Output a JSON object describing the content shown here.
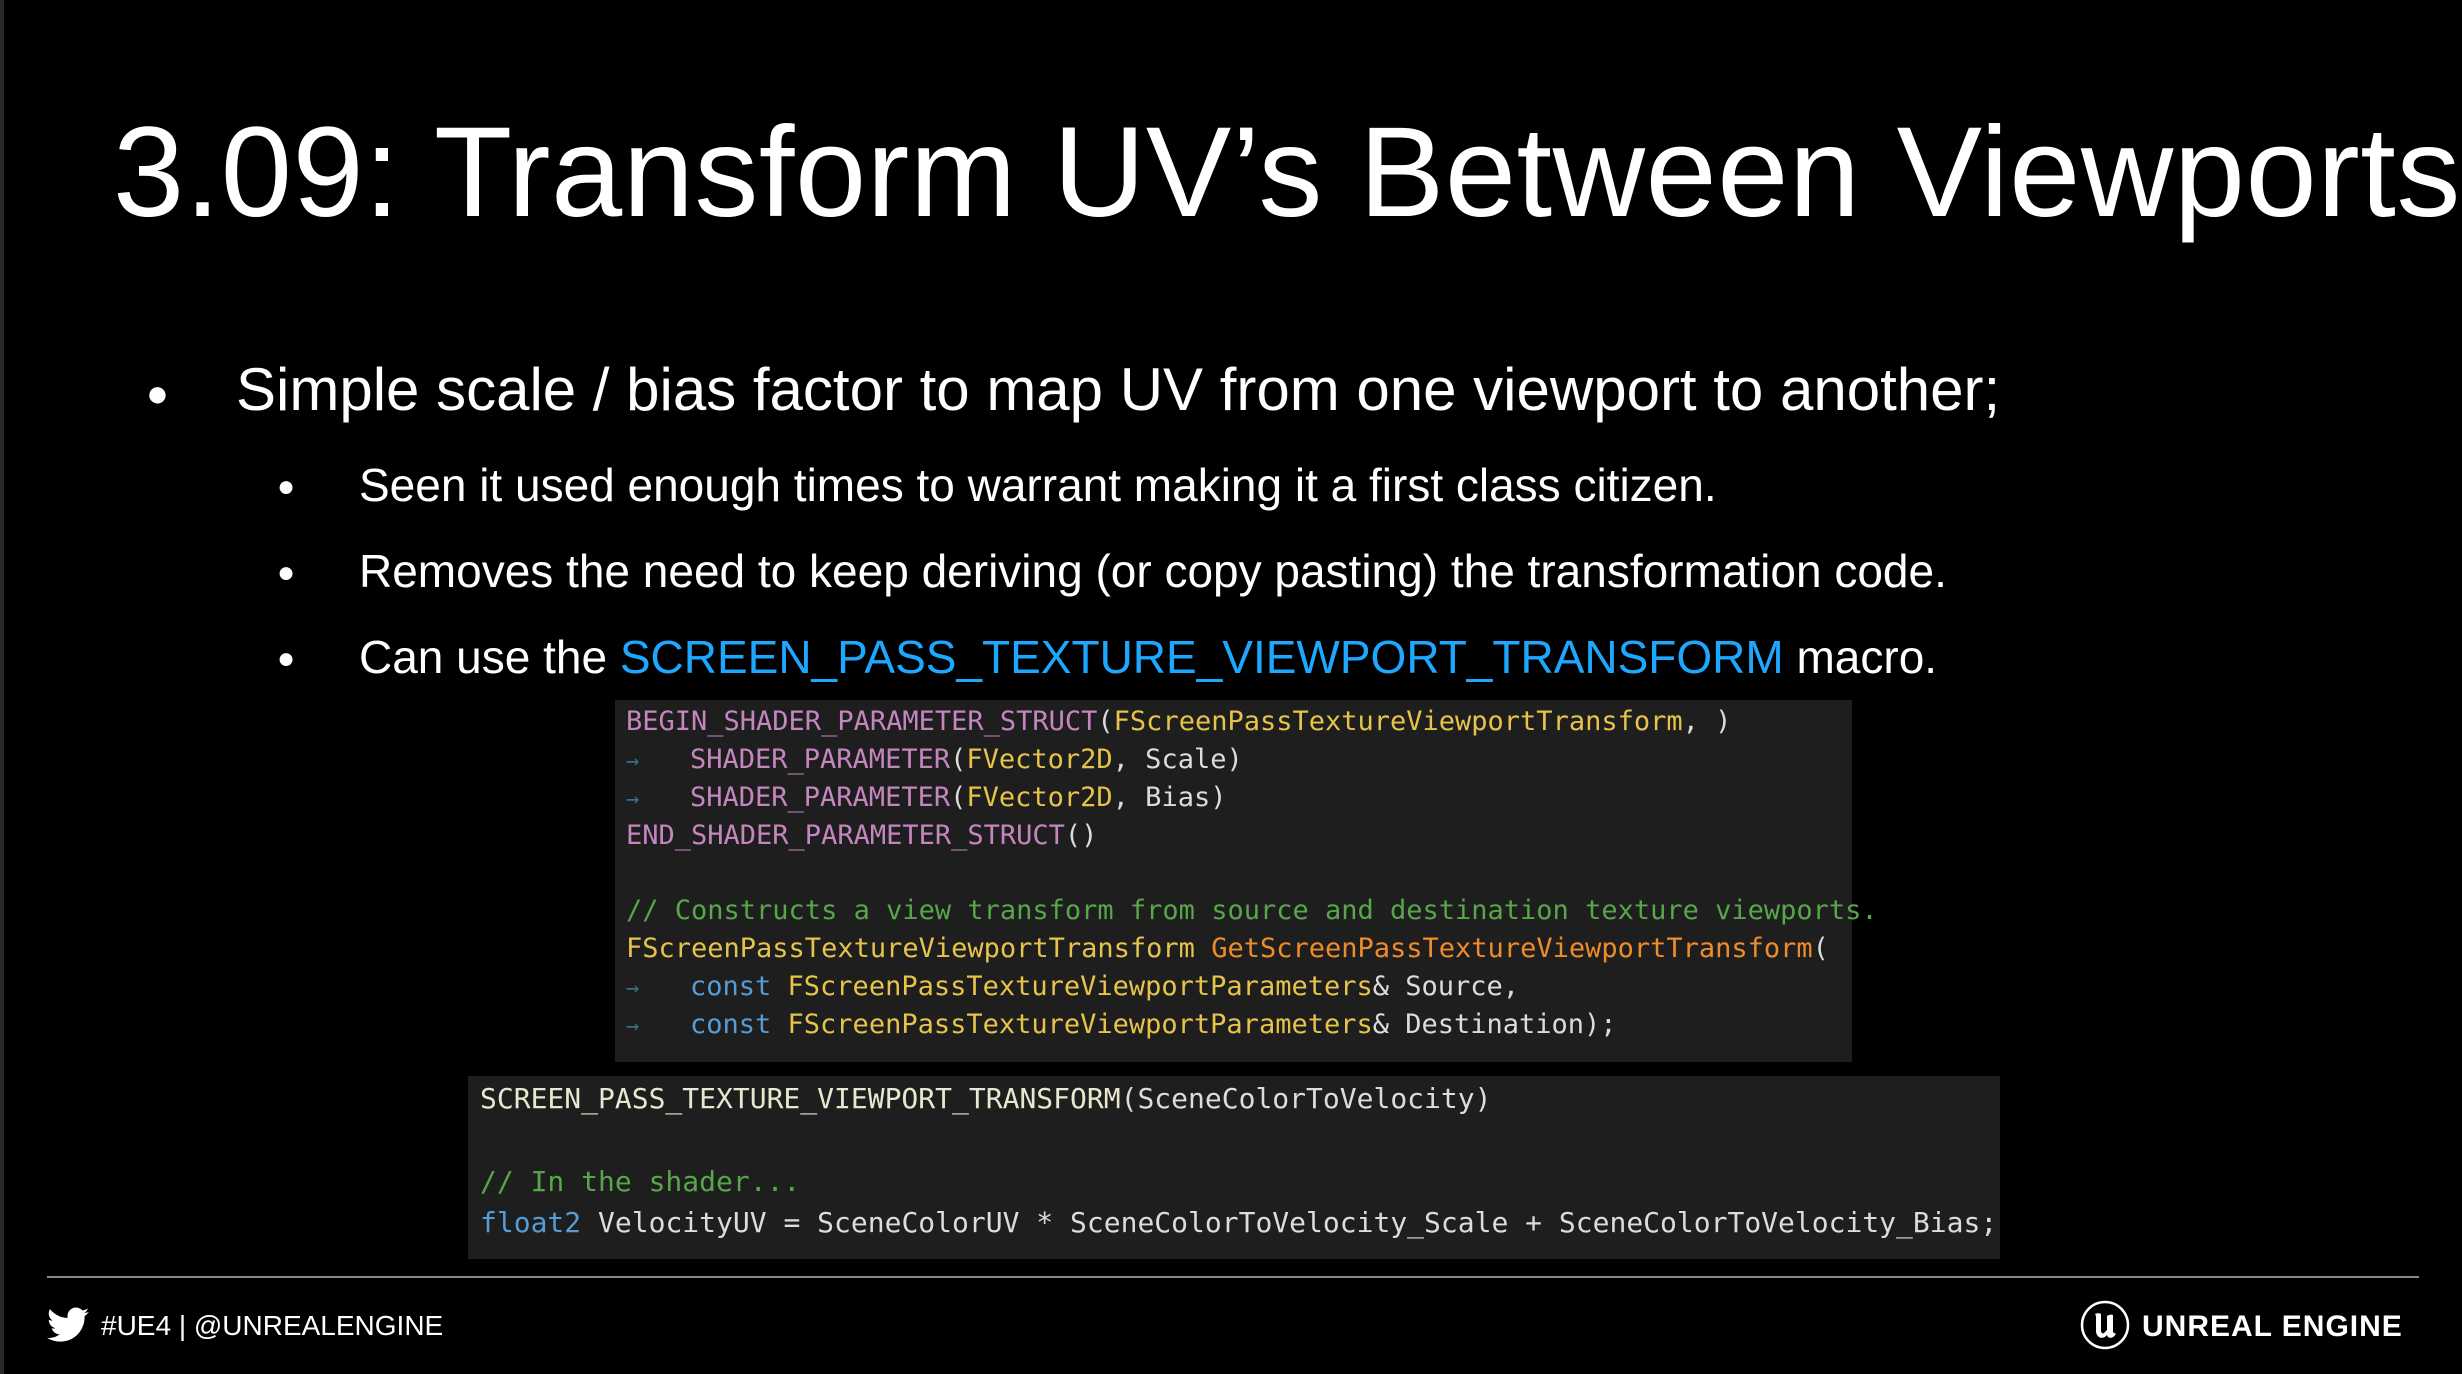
{
  "slide": {
    "title": "3.09: Transform UV’s Between Viewports"
  },
  "bullets": {
    "main": "Simple scale / bias factor to map UV from one viewport to another;",
    "bullet_symbol": "●",
    "sub": [
      "Seen it used enough times to warrant making it a first class citizen.",
      "Removes the need to keep deriving (or copy pasting) the transformation code."
    ],
    "macro_line": {
      "before": "Can use the ",
      "macro": "SCREEN_PASS_TEXTURE_VIEWPORT_TRANSFORM",
      "after": " macro."
    }
  },
  "code_block_1": {
    "line1": {
      "macro": "BEGIN_SHADER_PARAMETER_STRUCT",
      "open": "(",
      "type": "FScreenPassTextureViewportTransform",
      "rest": ", )"
    },
    "tab_glyph": "→",
    "line2": {
      "macro": "SHADER_PARAMETER",
      "open": "(",
      "type": "FVector2D",
      "rest": ", Scale)"
    },
    "line3": {
      "macro": "SHADER_PARAMETER",
      "open": "(",
      "type": "FVector2D",
      "rest": ", Bias)"
    },
    "line4": {
      "macro": "END_SHADER_PARAMETER_STRUCT",
      "rest": "()"
    },
    "line6": {
      "comment": "// Constructs a view transform from source and destination texture viewports."
    },
    "line7": {
      "type": "FScreenPassTextureViewportTransform",
      "space": " ",
      "func": "GetScreenPassTextureViewportTransform",
      "rest": "("
    },
    "line8": {
      "keyword": "const",
      "type": " FScreenPassTextureViewportParameters",
      "rest": "& Source,"
    },
    "line9": {
      "keyword": "const",
      "type": " FScreenPassTextureViewportParameters",
      "rest": "& Destination);"
    }
  },
  "code_block_2": {
    "line1": {
      "macro": "SCREEN_PASS_TEXTURE_VIEWPORT_TRANSFORM",
      "rest": "(SceneColorToVelocity)"
    },
    "line3": {
      "comment": "// In the shader..."
    },
    "line4": {
      "keyword": "float2",
      "rest": " VelocityUV = SceneColorUV * SceneColorToVelocity_Scale + SceneColorToVelocity_Bias;"
    }
  },
  "footer": {
    "social_text": "#UE4 | @UNREALENGINE",
    "brand_text": "UNREAL ENGINE",
    "twitter_icon": "twitter-bird-icon",
    "brand_icon": "unreal-engine-logo-icon"
  },
  "colors": {
    "background": "#000000",
    "text": "#ffffff",
    "macro_highlight": "#1ea7ff",
    "code_background": "#1e1e1e",
    "code_macro": "#c586c0",
    "code_type": "#e6c34a",
    "code_function": "#ee8c2a",
    "code_comment": "#57a64a",
    "code_keyword": "#569cd6"
  }
}
